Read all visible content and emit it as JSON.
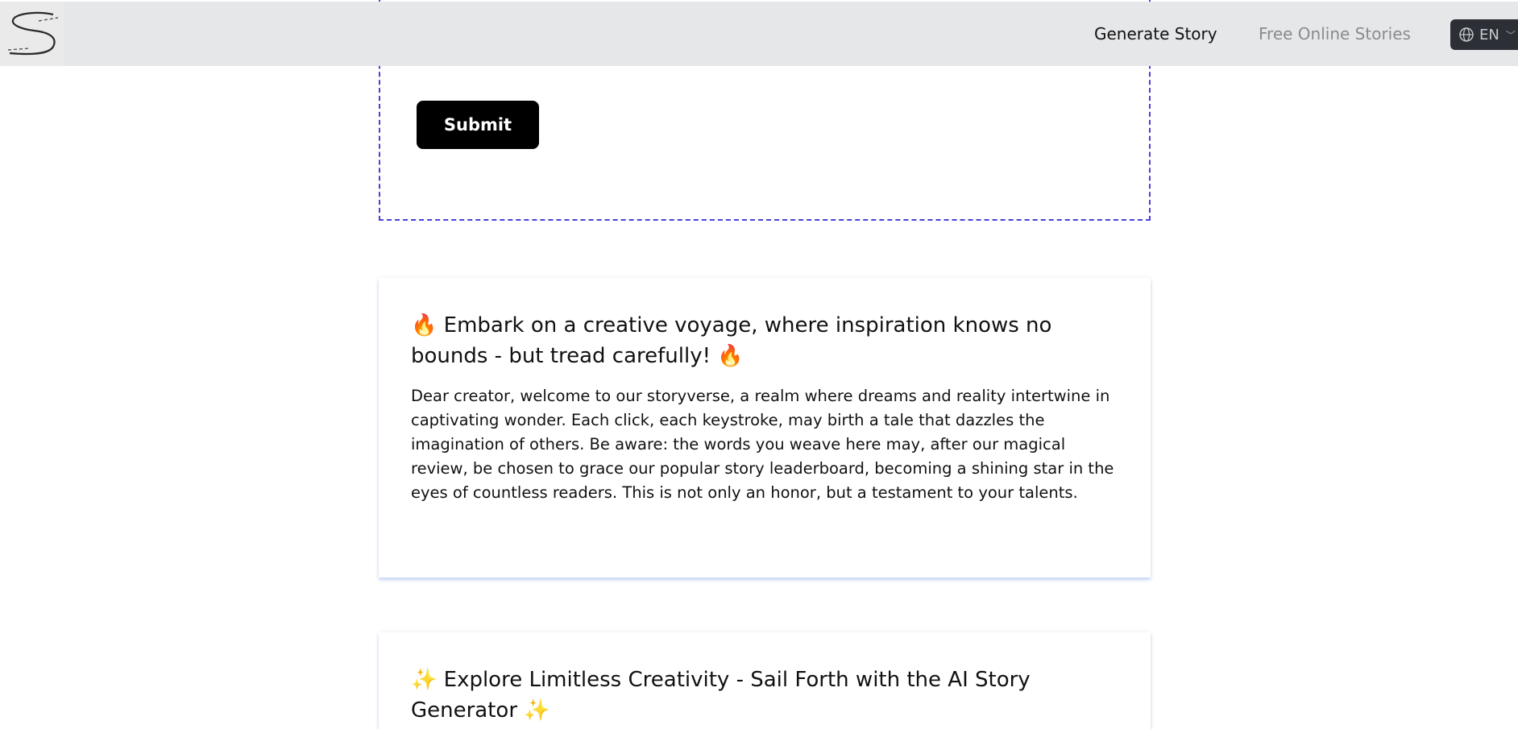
{
  "header": {
    "logo_alt": "S",
    "nav": {
      "generate_story": "Generate Story",
      "free_online_stories": "Free Online Stories"
    },
    "language": {
      "selected": "EN",
      "icon": "globe-icon"
    }
  },
  "form": {
    "submit_label": "Submit"
  },
  "cards": [
    {
      "title": "🔥 Embark on a creative voyage, where inspiration knows no bounds - but tread carefully! 🔥",
      "body": "Dear creator, welcome to our storyverse, a realm where dreams and reality intertwine in captivating wonder. Each click, each keystroke, may birth a tale that dazzles the imagination of others. Be aware: the words you weave here may, after our magical review, be chosen to grace our popular story leaderboard, becoming a shining star in the eyes of countless readers. This is not only an honor, but a testament to your talents."
    },
    {
      "title": "✨ Explore Limitless Creativity - Sail Forth with the AI Story Generator ✨"
    }
  ],
  "colors": {
    "header_bg": "#e6e7e9",
    "nav_active": "#111111",
    "nav_inactive": "#8a8b8f",
    "lang_bg": "#2c2f36",
    "dashed_border": "#4b3fd6",
    "button_bg": "#000000"
  }
}
